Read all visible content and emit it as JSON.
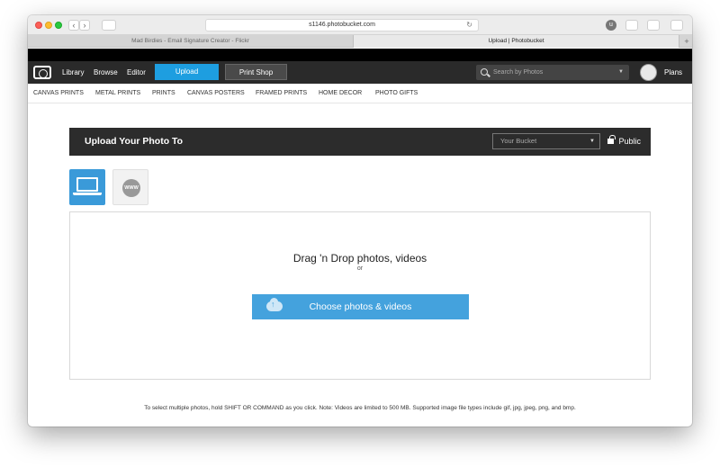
{
  "browser": {
    "url": "s1146.photobucket.com",
    "tabs": [
      {
        "label": "Mad Birdies - Email Signature Creator - Flickr"
      },
      {
        "label": "Upload | Photobucket"
      }
    ],
    "tab_add": "+",
    "nav_back": "‹",
    "nav_forward": "›",
    "reload": "↻",
    "ext_badge": "u"
  },
  "appnav": {
    "library": "Library",
    "browse": "Browse",
    "editor": "Editor",
    "upload": "Upload",
    "print_shop": "Print Shop",
    "search_placeholder": "Search by Photos",
    "plans": "Plans"
  },
  "subnav": {
    "items": [
      {
        "label": "CANVAS PRINTS"
      },
      {
        "label": "METAL PRINTS"
      },
      {
        "label": "PRINTS"
      },
      {
        "label": "CANVAS POSTERS"
      },
      {
        "label": "FRAMED PRINTS"
      },
      {
        "label": "HOME DECOR"
      },
      {
        "label": "PHOTO GIFTS"
      }
    ]
  },
  "upload": {
    "title": "Upload Your Photo To",
    "bucket": "Your Bucket",
    "privacy": "Public",
    "www": "WWW",
    "drop_title": "Drag 'n Drop photos, videos",
    "drop_or": "or",
    "choose_button": "Choose photos & videos",
    "footnote": "To select multiple photos, hold SHIFT OR COMMAND as you click. Note: Videos are limited to 500 MB. Supported image file types include gif, jpg, jpeg, png, and bmp."
  },
  "colors": {
    "accent": "#1e9ee0",
    "nav_bg": "#2a2a2a",
    "choose_button": "#44a2dd"
  }
}
